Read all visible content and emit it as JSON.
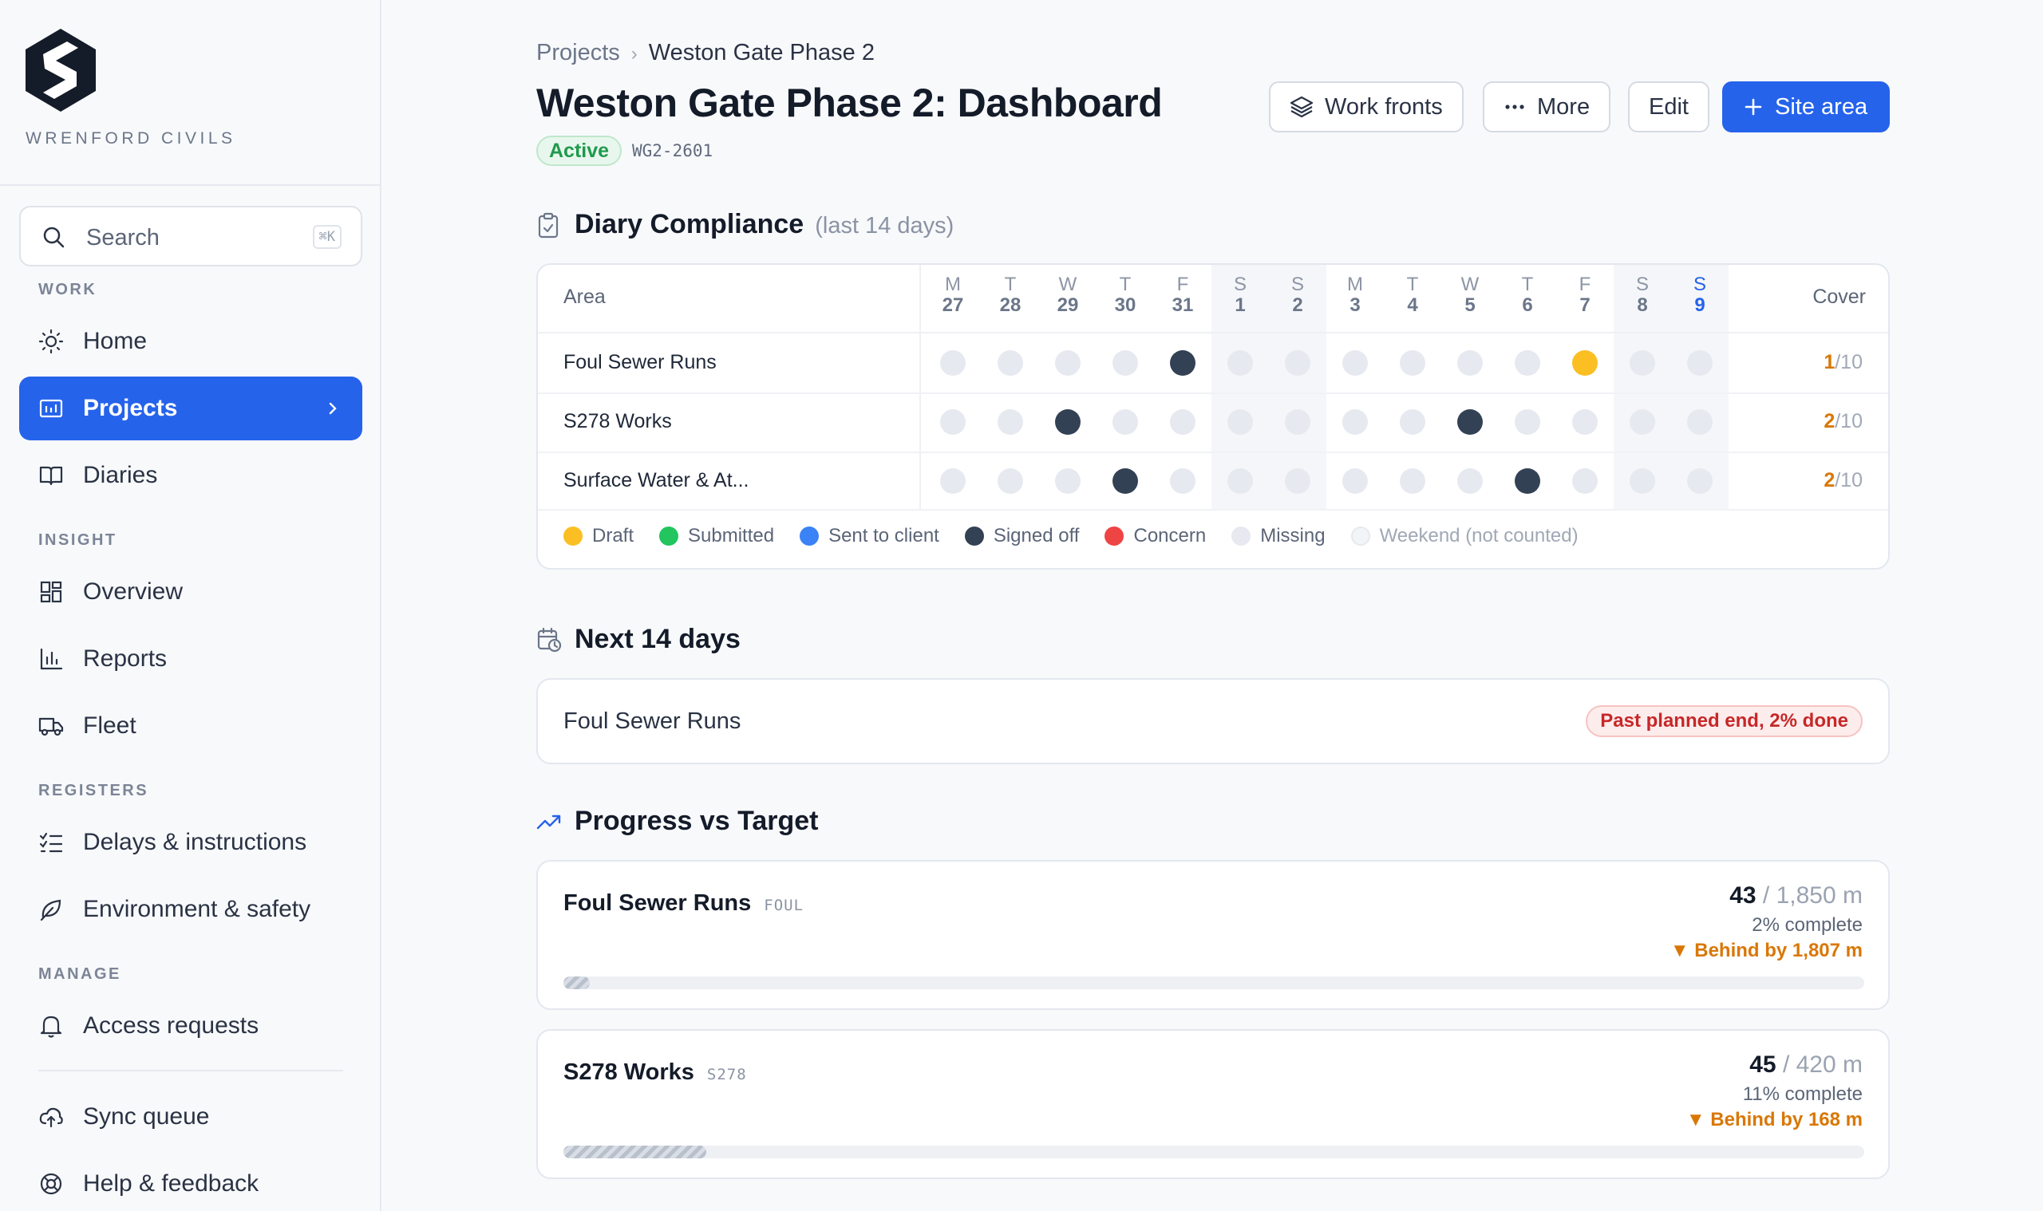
{
  "brand": {
    "name": "WRENFORD CIVILS"
  },
  "search": {
    "placeholder": "Search",
    "shortcut": "⌘K"
  },
  "sidebar": {
    "sections": {
      "work": "WORK",
      "insight": "INSIGHT",
      "registers": "REGISTERS",
      "manage": "MANAGE"
    },
    "items": [
      {
        "label": "Home",
        "icon": "sun-icon"
      },
      {
        "label": "Projects",
        "icon": "folder-icon",
        "active": true
      },
      {
        "label": "Diaries",
        "icon": "book-icon"
      },
      {
        "label": "Overview",
        "icon": "grid-icon"
      },
      {
        "label": "Reports",
        "icon": "bar-chart-icon"
      },
      {
        "label": "Fleet",
        "icon": "truck-icon"
      },
      {
        "label": "Delays & instructions",
        "icon": "checklist-icon"
      },
      {
        "label": "Environment & safety",
        "icon": "leaf-icon"
      },
      {
        "label": "Access requests",
        "icon": "bell-icon"
      },
      {
        "label": "Sync queue",
        "icon": "cloud-upload-icon"
      },
      {
        "label": "Help & feedback",
        "icon": "lifebuoy-icon"
      }
    ]
  },
  "breadcrumb": {
    "parent": "Projects",
    "current": "Weston Gate Phase 2"
  },
  "page": {
    "title": "Weston Gate Phase 2: Dashboard",
    "status": "Active",
    "code": "WG2-2601"
  },
  "actions": {
    "work_fronts": "Work fronts",
    "more": "More",
    "edit": "Edit",
    "site_area": "Site area"
  },
  "compliance": {
    "title": "Diary Compliance",
    "subtitle": "(last 14 days)",
    "area_header": "Area",
    "cover_header": "Cover",
    "days": [
      {
        "l": "M",
        "n": "27"
      },
      {
        "l": "T",
        "n": "28"
      },
      {
        "l": "W",
        "n": "29"
      },
      {
        "l": "T",
        "n": "30"
      },
      {
        "l": "F",
        "n": "31"
      },
      {
        "l": "S",
        "n": "1",
        "weekend": true
      },
      {
        "l": "S",
        "n": "2",
        "weekend": true
      },
      {
        "l": "M",
        "n": "3"
      },
      {
        "l": "T",
        "n": "4"
      },
      {
        "l": "W",
        "n": "5"
      },
      {
        "l": "T",
        "n": "6"
      },
      {
        "l": "F",
        "n": "7"
      },
      {
        "l": "S",
        "n": "8",
        "weekend": true
      },
      {
        "l": "S",
        "n": "9",
        "weekend": true,
        "today": true
      }
    ],
    "rows": [
      {
        "name": "Foul Sewer Runs",
        "cells": [
          "m",
          "m",
          "m",
          "m",
          "s",
          "w",
          "w",
          "m",
          "m",
          "m",
          "m",
          "d",
          "w",
          "w"
        ],
        "covered": "1",
        "total": "/10"
      },
      {
        "name": "S278 Works",
        "cells": [
          "m",
          "m",
          "s",
          "m",
          "m",
          "w",
          "w",
          "m",
          "m",
          "s",
          "m",
          "m",
          "w",
          "w"
        ],
        "covered": "2",
        "total": "/10"
      },
      {
        "name": "Surface Water & At...",
        "cells": [
          "m",
          "m",
          "m",
          "s",
          "m",
          "w",
          "w",
          "m",
          "m",
          "m",
          "s",
          "m",
          "w",
          "w"
        ],
        "covered": "2",
        "total": "/10"
      }
    ],
    "legend": [
      {
        "label": "Draft",
        "color": "#fbbf24"
      },
      {
        "label": "Submitted",
        "color": "#22c55e"
      },
      {
        "label": "Sent to client",
        "color": "#3b82f6"
      },
      {
        "label": "Signed off",
        "color": "#334155"
      },
      {
        "label": "Concern",
        "color": "#ef4444"
      },
      {
        "label": "Missing",
        "color": "#e6e9ef"
      },
      {
        "label": "Weekend (not counted)",
        "color": "#f3f4f7"
      }
    ]
  },
  "next14": {
    "title": "Next 14 days",
    "item": "Foul Sewer Runs",
    "status": "Past planned end, 2% done"
  },
  "progress": {
    "title": "Progress vs Target",
    "items": [
      {
        "name": "Foul Sewer Runs",
        "code": "FOUL",
        "done": "43",
        "target": "/ 1,850 m",
        "pct_label": "2% complete",
        "behind": "▼ Behind by 1,807 m",
        "pct": 2
      },
      {
        "name": "S278 Works",
        "code": "S278",
        "done": "45",
        "target": "/ 420 m",
        "pct_label": "11% complete",
        "behind": "▼ Behind by 168 m",
        "pct": 11
      }
    ]
  },
  "colors": {
    "accent": "#2563eb",
    "signed_off": "#334155",
    "draft": "#fbbf24",
    "missing": "#e6e9ef",
    "warning": "#d97706"
  }
}
